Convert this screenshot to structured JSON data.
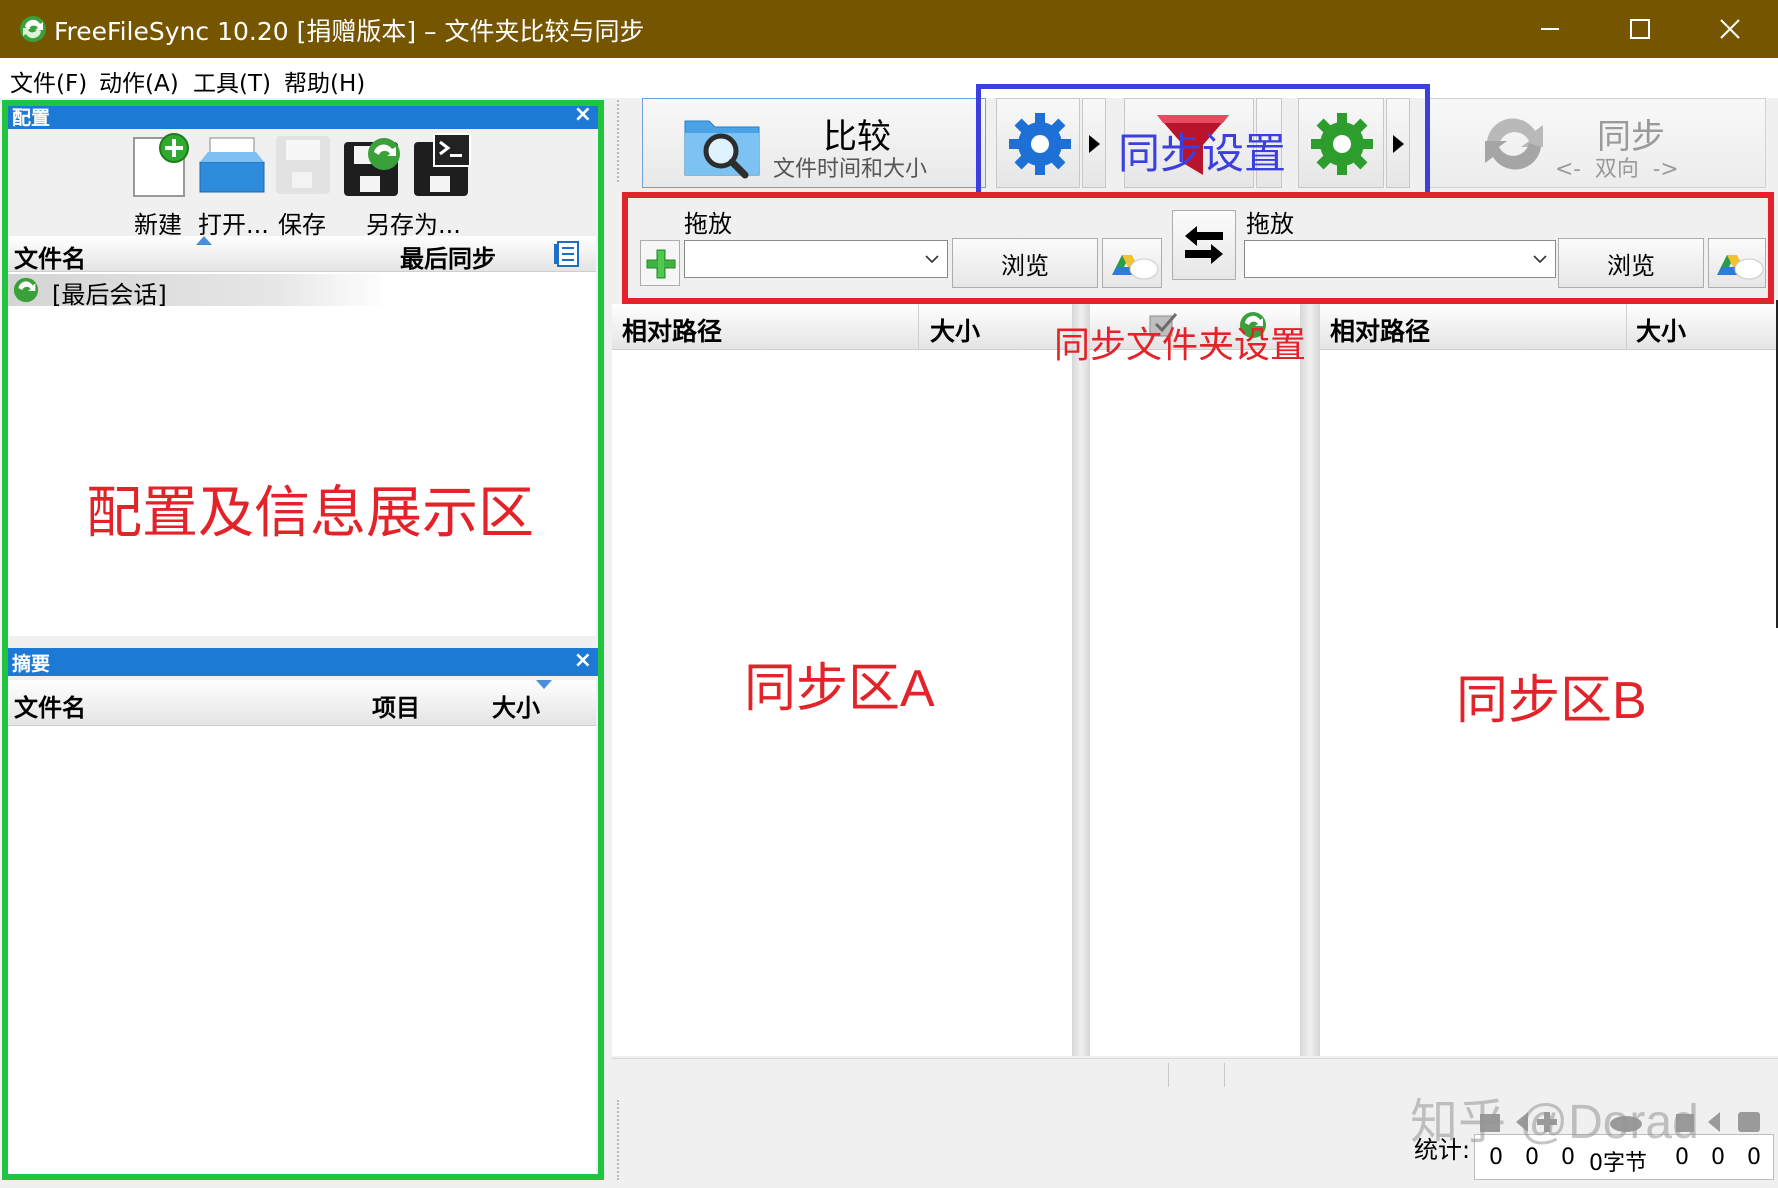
{
  "window": {
    "title": "FreeFileSync 10.20 [捐赠版本] – 文件夹比较与同步"
  },
  "menu": [
    "文件(F)",
    "动作(A)",
    "工具(T)",
    "帮助(H)"
  ],
  "config_panel": {
    "title": "配置",
    "close": "×",
    "toolbar": {
      "new": "新建",
      "open": "打开...",
      "save": "保存",
      "save_as": "另存为..."
    },
    "columns": {
      "filename": "文件名",
      "last_sync": "最后同步"
    },
    "items": [
      "[最后会话]"
    ]
  },
  "summary_panel": {
    "title": "摘要",
    "close": "×",
    "columns": {
      "filename": "文件名",
      "items": "项目",
      "size": "大小"
    }
  },
  "compare_button": {
    "title": "比较",
    "subtitle": "文件时间和大小"
  },
  "sync_button": {
    "title": "同步",
    "subtitle": "<-  双向  ->"
  },
  "folder_a": {
    "drop_label": "拖放",
    "browse": "浏览",
    "path": ""
  },
  "folder_b": {
    "drop_label": "拖放",
    "browse": "浏览",
    "path": ""
  },
  "grid_left": {
    "col_path": "相对路径",
    "col_size": "大小"
  },
  "grid_right": {
    "col_path": "相对路径",
    "col_size": "大小"
  },
  "status": {
    "label": "统计:",
    "counts": [
      "0",
      "0",
      "0",
      "0字节",
      "0",
      "0",
      "0"
    ]
  },
  "annotations": {
    "config_area": "配置及信息展示区",
    "sync_settings": "同步设置",
    "sync_folder_settings": "同步文件夹设置",
    "sync_area_a": "同步区A",
    "sync_area_b": "同步区B",
    "watermark": "知乎 @Dorad"
  },
  "colors": {
    "titlebar": "#765500",
    "panel_header": "#1c7ad4",
    "annotation_green": "#1fc53e",
    "annotation_blue": "#3b3fe0",
    "annotation_red": "#e3232a"
  }
}
